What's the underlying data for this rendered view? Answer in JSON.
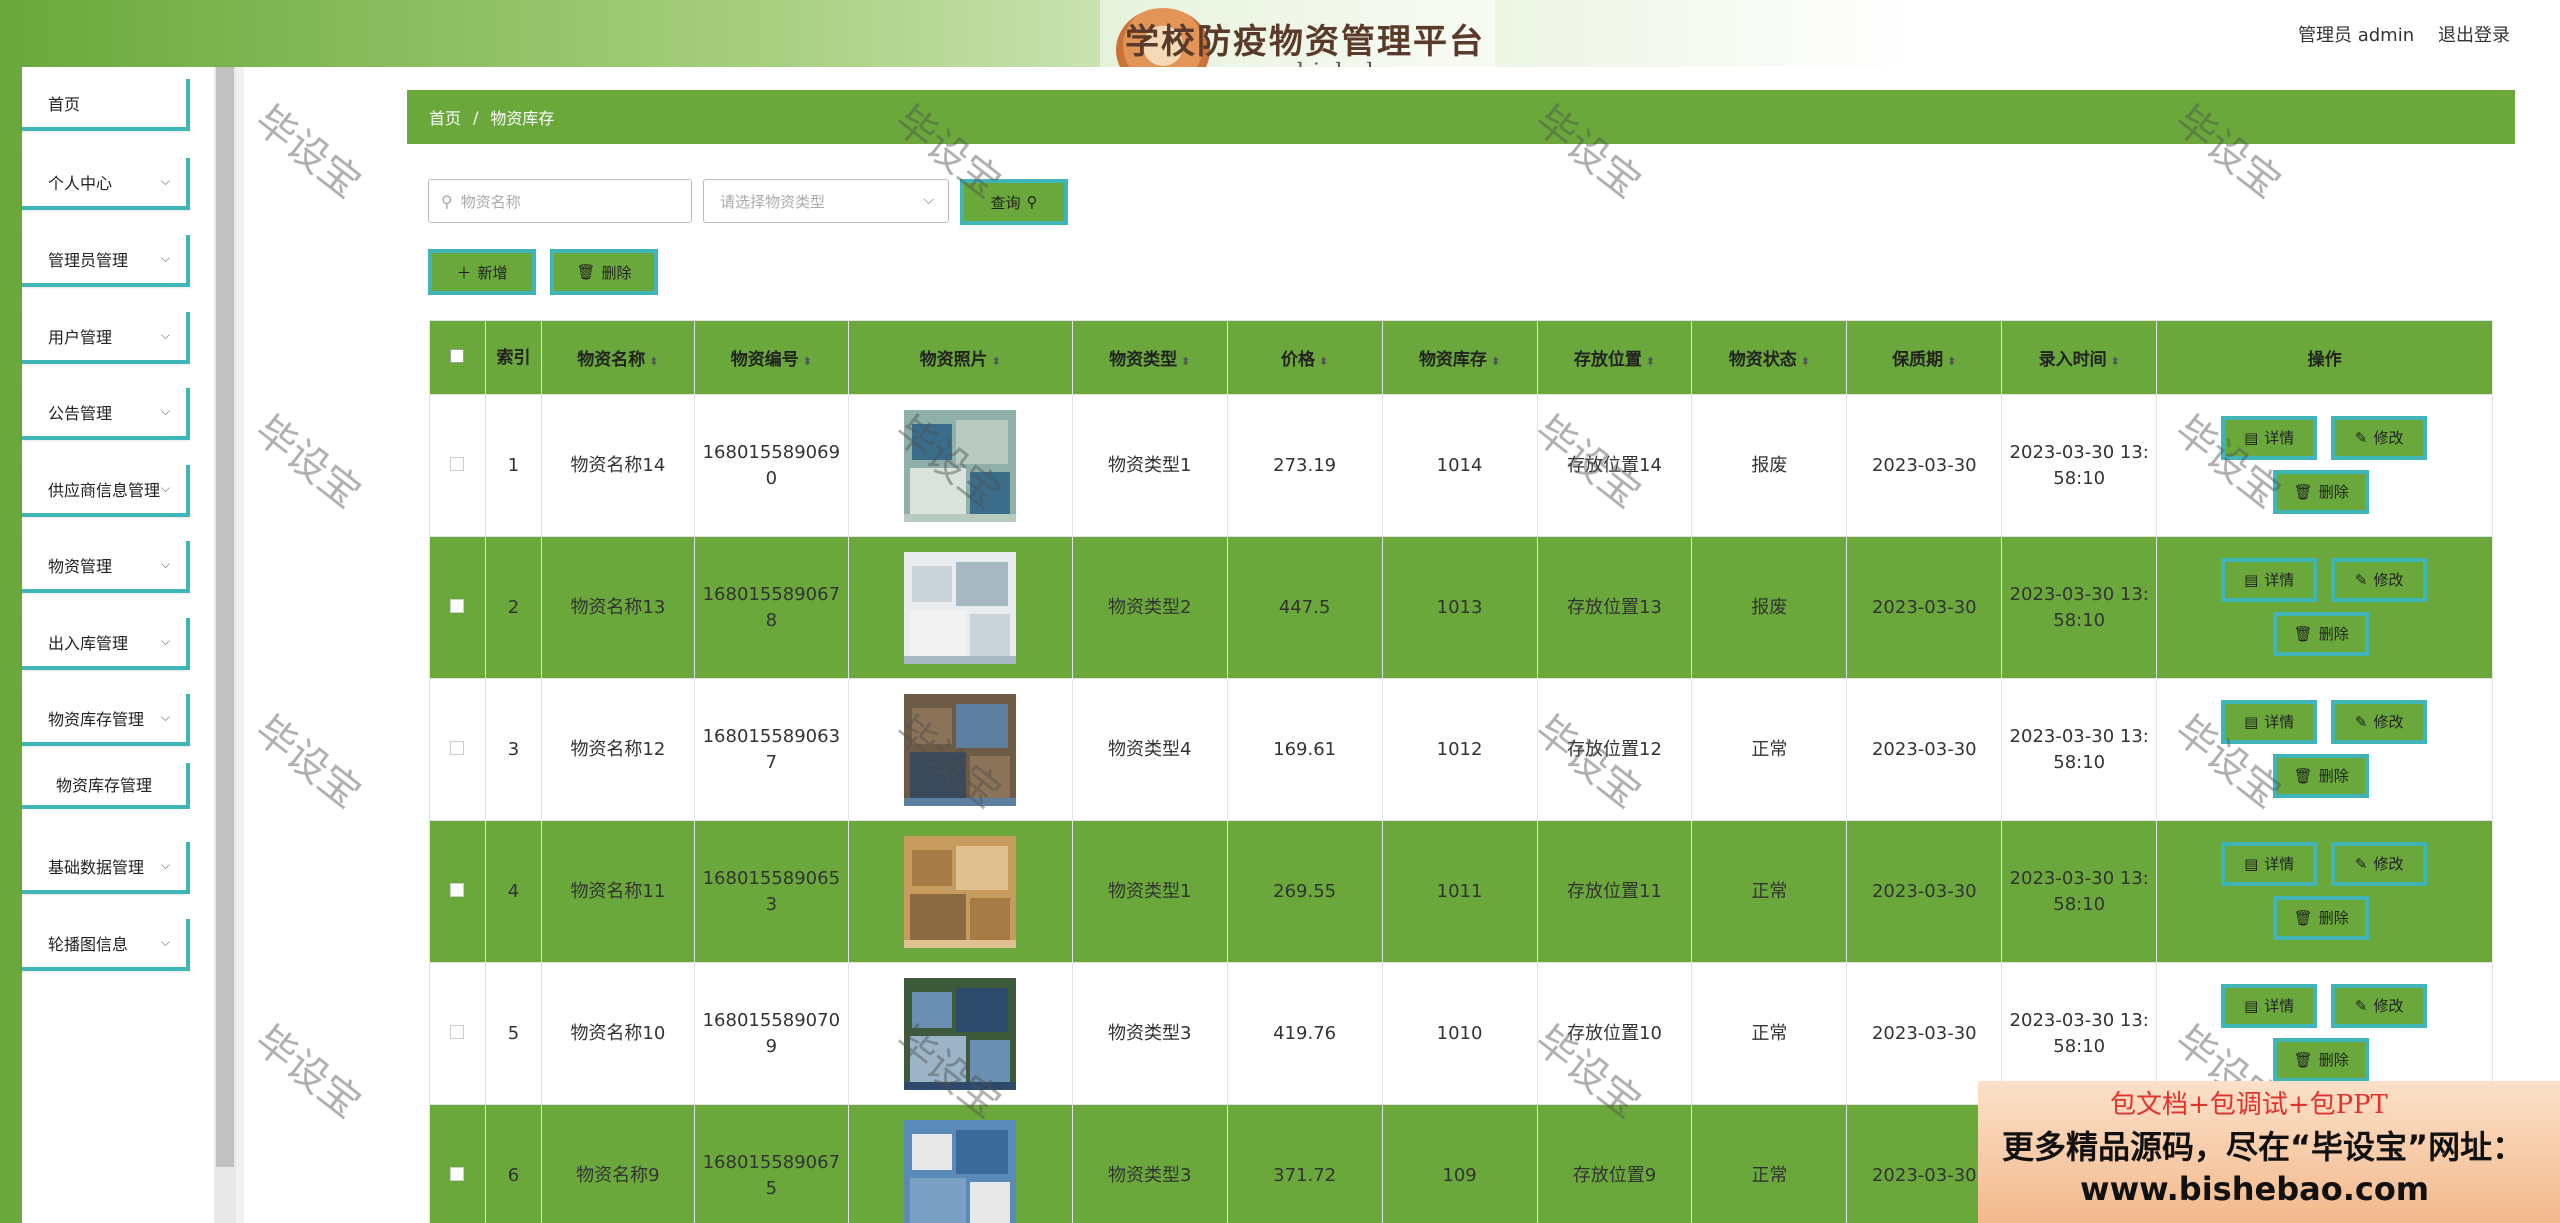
{
  "header": {
    "brand_title": "学校防疫物资管理平台",
    "brand_watermark": "毕设宝源码网",
    "brand_url": "www.bishebao.com",
    "admin_label": "管理员 admin",
    "logout_label": "退出登录"
  },
  "sidebar": {
    "items": [
      {
        "label": "首页"
      },
      {
        "label": "个人中心"
      },
      {
        "label": "管理员管理"
      },
      {
        "label": "用户管理"
      },
      {
        "label": "公告管理"
      },
      {
        "label": "供应商信息管理"
      },
      {
        "label": "物资管理"
      },
      {
        "label": "出入库管理"
      },
      {
        "label": "物资库存管理"
      },
      {
        "label": "物资库存管理"
      },
      {
        "label": "基础数据管理"
      },
      {
        "label": "轮播图信息"
      }
    ]
  },
  "breadcrumb": {
    "home": "首页",
    "sep": "/",
    "current": "物资库存"
  },
  "search": {
    "name_placeholder": "物资名称",
    "type_placeholder": "请选择物资类型",
    "query_label": "查询"
  },
  "toolbar": {
    "add_label": "新增",
    "delete_label": "删除"
  },
  "table": {
    "headers": [
      "索引",
      "物资名称",
      "物资编号",
      "物资照片",
      "物资类型",
      "价格",
      "物资库存",
      "存放位置",
      "物资状态",
      "保质期",
      "录入时间",
      "操作"
    ],
    "actions": {
      "detail": "详情",
      "edit": "修改",
      "delete": "删除"
    },
    "rows": [
      {
        "idx": "1",
        "name": "物资名称14",
        "code_a": "168015589069",
        "code_b": "0",
        "type": "物资类型1",
        "price": "273.19",
        "stock": "1014",
        "location": "存放位置14",
        "status": "报废",
        "shelf_life": "2023-03-30",
        "time_a": "2023-03-30 13:",
        "time_b": "58:10"
      },
      {
        "idx": "2",
        "name": "物资名称13",
        "code_a": "168015589067",
        "code_b": "8",
        "type": "物资类型2",
        "price": "447.5",
        "stock": "1013",
        "location": "存放位置13",
        "status": "报废",
        "shelf_life": "2023-03-30",
        "time_a": "2023-03-30 13:",
        "time_b": "58:10"
      },
      {
        "idx": "3",
        "name": "物资名称12",
        "code_a": "168015589063",
        "code_b": "7",
        "type": "物资类型4",
        "price": "169.61",
        "stock": "1012",
        "location": "存放位置12",
        "status": "正常",
        "shelf_life": "2023-03-30",
        "time_a": "2023-03-30 13:",
        "time_b": "58:10"
      },
      {
        "idx": "4",
        "name": "物资名称11",
        "code_a": "168015589065",
        "code_b": "3",
        "type": "物资类型1",
        "price": "269.55",
        "stock": "1011",
        "location": "存放位置11",
        "status": "正常",
        "shelf_life": "2023-03-30",
        "time_a": "2023-03-30 13:",
        "time_b": "58:10"
      },
      {
        "idx": "5",
        "name": "物资名称10",
        "code_a": "168015589070",
        "code_b": "9",
        "type": "物资类型3",
        "price": "419.76",
        "stock": "1010",
        "location": "存放位置10",
        "status": "正常",
        "shelf_life": "2023-03-30",
        "time_a": "2023-03-30 13:",
        "time_b": "58:10"
      },
      {
        "idx": "6",
        "name": "物资名称9",
        "code_a": "168015589067",
        "code_b": "5",
        "type": "物资类型3",
        "price": "371.72",
        "stock": "109",
        "location": "存放位置9",
        "status": "正常",
        "shelf_life": "2023-03-30",
        "time_a": "",
        "time_b": ""
      }
    ]
  },
  "watermark_text": "毕设宝",
  "promo": {
    "line1": "包文档+包调试+包PPT",
    "line2": "更多精品源码，尽在“毕设宝”网址：",
    "line3": "www.bishebao.com"
  },
  "colors": {
    "primary_green": "#6aa83b",
    "accent_teal": "#3fb5b7",
    "promo_red": "#e2322c"
  }
}
